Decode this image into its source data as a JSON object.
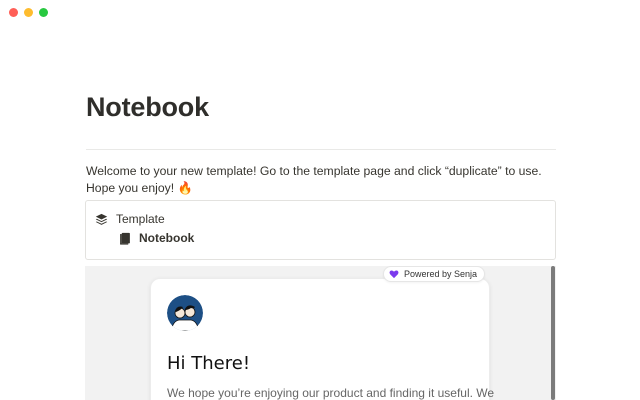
{
  "window": {
    "traffic_lights": [
      {
        "name": "close",
        "color": "#ff5f57"
      },
      {
        "name": "minimize",
        "color": "#febc2e"
      },
      {
        "name": "zoom",
        "color": "#28c840"
      }
    ]
  },
  "page": {
    "title": "Notebook",
    "intro": "Welcome to your new template! Go to the template page and click “duplicate” to use. Hope you enjoy! 🔥"
  },
  "breadcrumb": {
    "parent_icon": "layers-icon",
    "parent_label": "Template",
    "child_icon": "notebook-icon",
    "child_label": "Notebook"
  },
  "embed": {
    "badge_label": "Powered by Senja",
    "badge_icon": "heart-icon",
    "badge_color": "#7c3aed",
    "card_title": "Hi There!",
    "card_text": "We hope you’re enjoying our product and finding it useful. We"
  }
}
